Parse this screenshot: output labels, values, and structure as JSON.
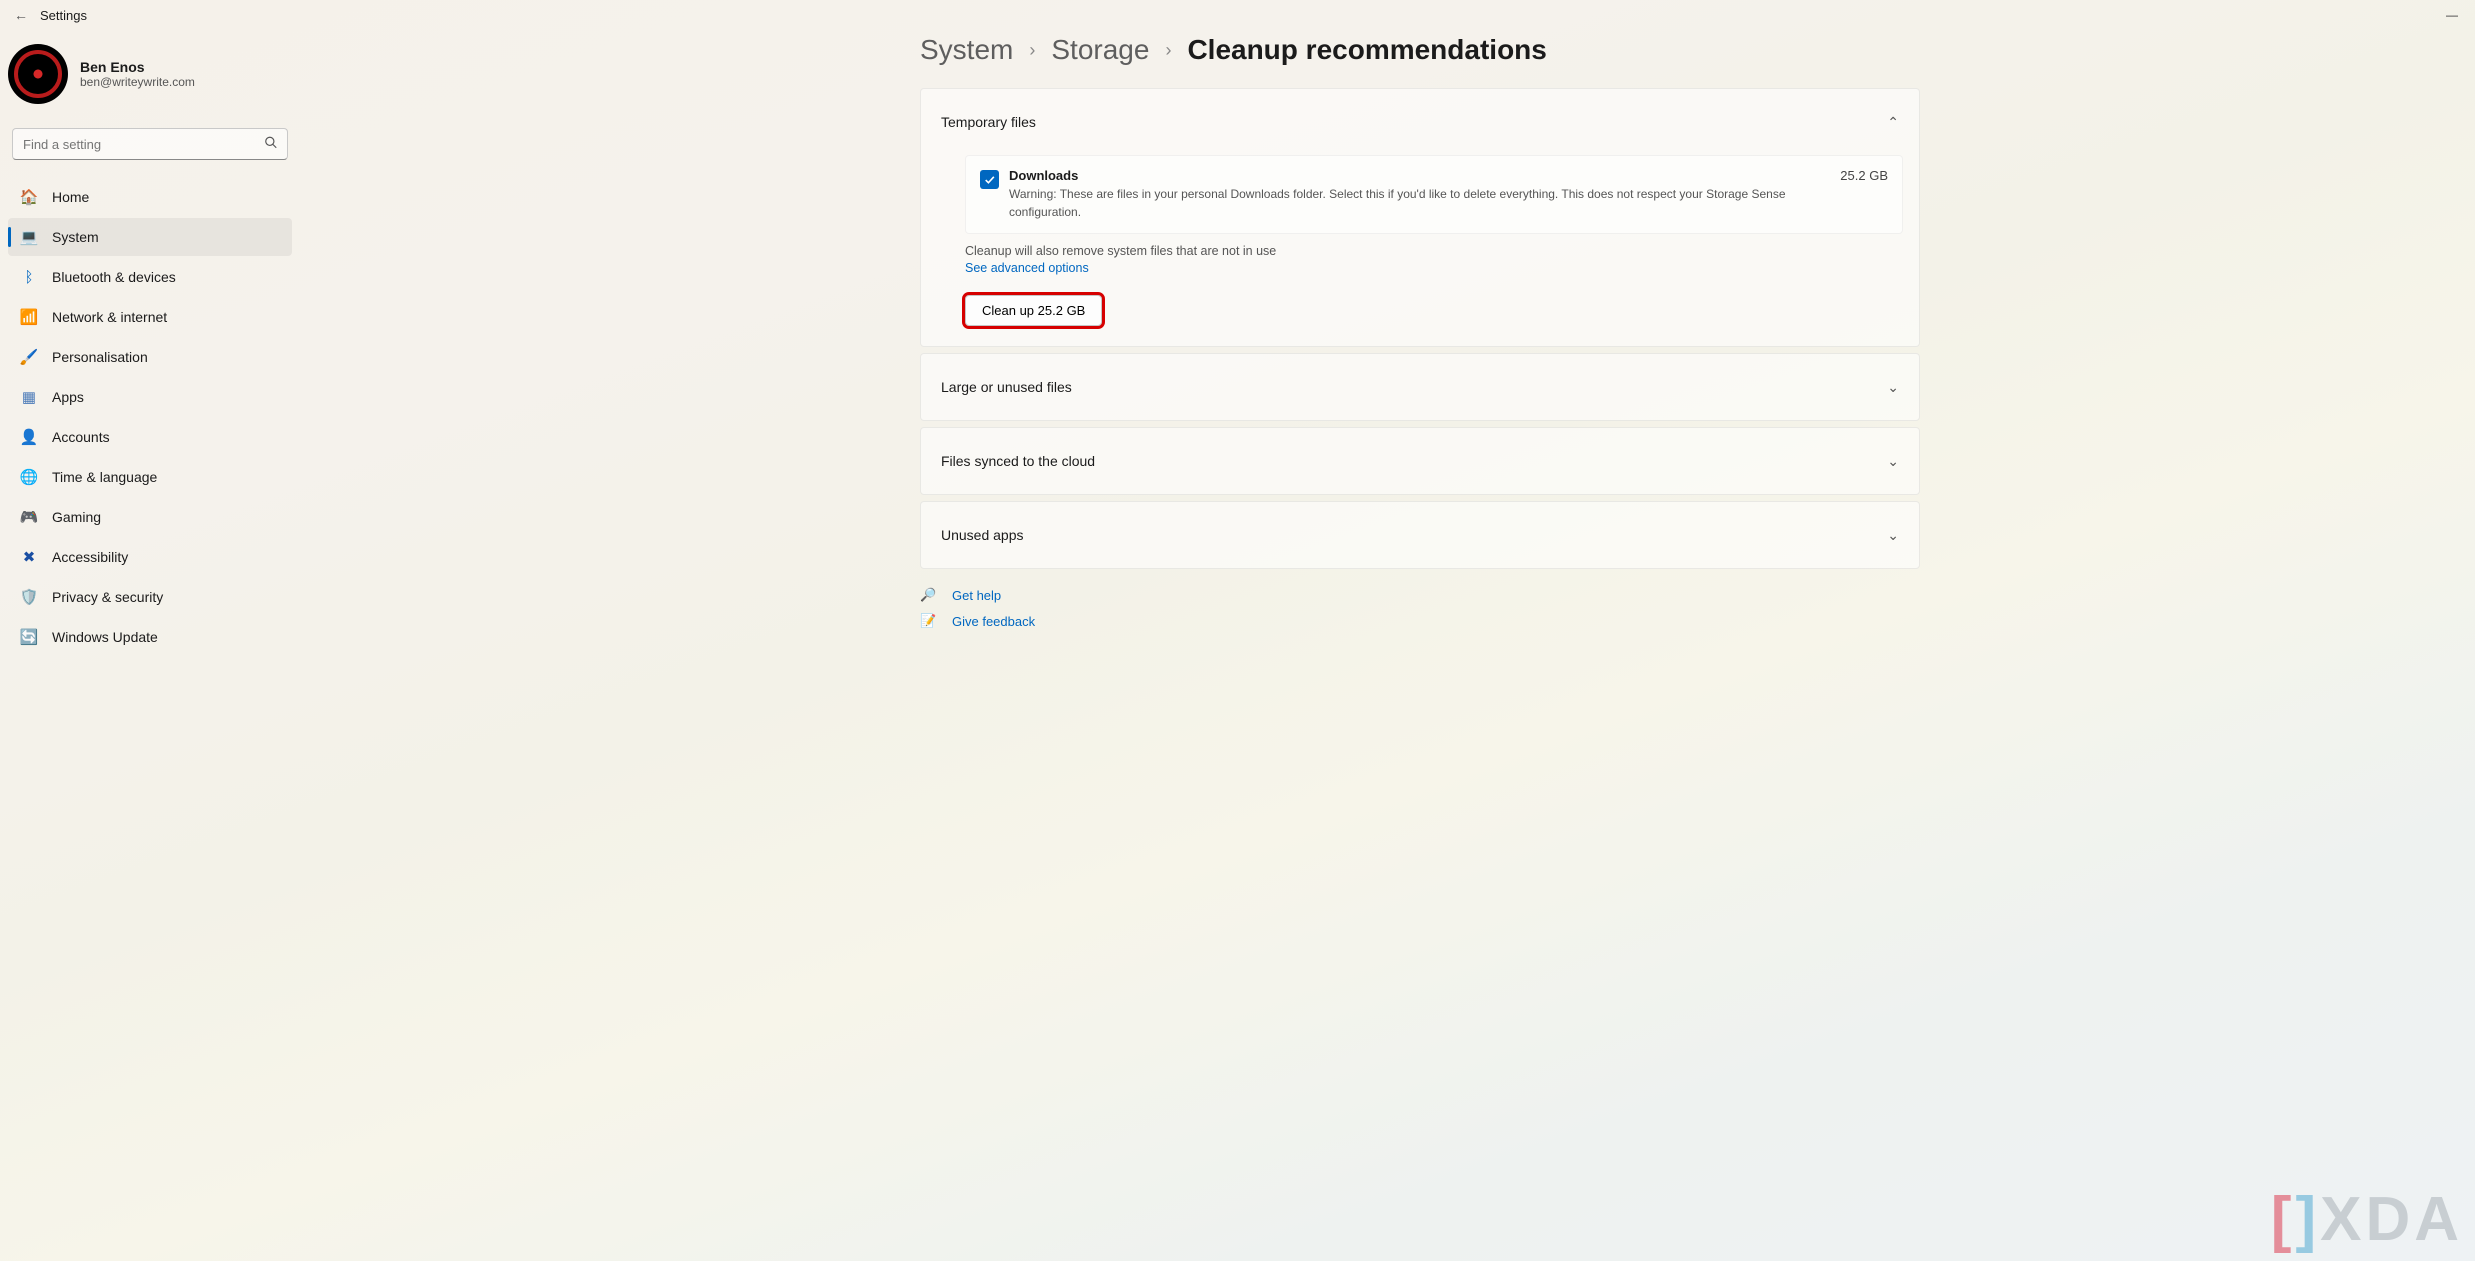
{
  "titlebar": {
    "appTitle": "Settings"
  },
  "profile": {
    "name": "Ben Enos",
    "email": "ben@writeywrite.com"
  },
  "search": {
    "placeholder": "Find a setting"
  },
  "nav": [
    {
      "icon": "🏠",
      "label": "Home",
      "id": "home"
    },
    {
      "icon": "💻",
      "label": "System",
      "id": "system",
      "active": true
    },
    {
      "icon": "ᛒ",
      "label": "Bluetooth & devices",
      "id": "bluetooth",
      "iconColor": "#0067c0"
    },
    {
      "icon": "📶",
      "label": "Network & internet",
      "id": "network"
    },
    {
      "icon": "🖌️",
      "label": "Personalisation",
      "id": "personalisation"
    },
    {
      "icon": "▦",
      "label": "Apps",
      "id": "apps",
      "iconColor": "#4a7ab8"
    },
    {
      "icon": "👤",
      "label": "Accounts",
      "id": "accounts"
    },
    {
      "icon": "🌐",
      "label": "Time & language",
      "id": "time"
    },
    {
      "icon": "🎮",
      "label": "Gaming",
      "id": "gaming"
    },
    {
      "icon": "✖",
      "label": "Accessibility",
      "id": "accessibility",
      "iconColor": "#1a4fa3"
    },
    {
      "icon": "🛡️",
      "label": "Privacy & security",
      "id": "privacy"
    },
    {
      "icon": "🔄",
      "label": "Windows Update",
      "id": "update",
      "iconColor": "#0067c0"
    }
  ],
  "breadcrumbs": {
    "first": "System",
    "second": "Storage",
    "current": "Cleanup recommendations"
  },
  "temp": {
    "header": "Temporary files",
    "downloads": {
      "title": "Downloads",
      "size": "25.2 GB",
      "warning": "Warning: These are files in your personal Downloads folder. Select this if you'd like to delete everything. This does not respect your Storage Sense configuration."
    },
    "note": "Cleanup will also remove system files that are not in use",
    "advanced": "See advanced options",
    "button": "Clean up 25.2 GB"
  },
  "sections": {
    "large": "Large or unused files",
    "synced": "Files synced to the cloud",
    "unused": "Unused apps"
  },
  "help": {
    "getHelp": "Get help",
    "feedback": "Give feedback"
  },
  "watermark": "XDA"
}
